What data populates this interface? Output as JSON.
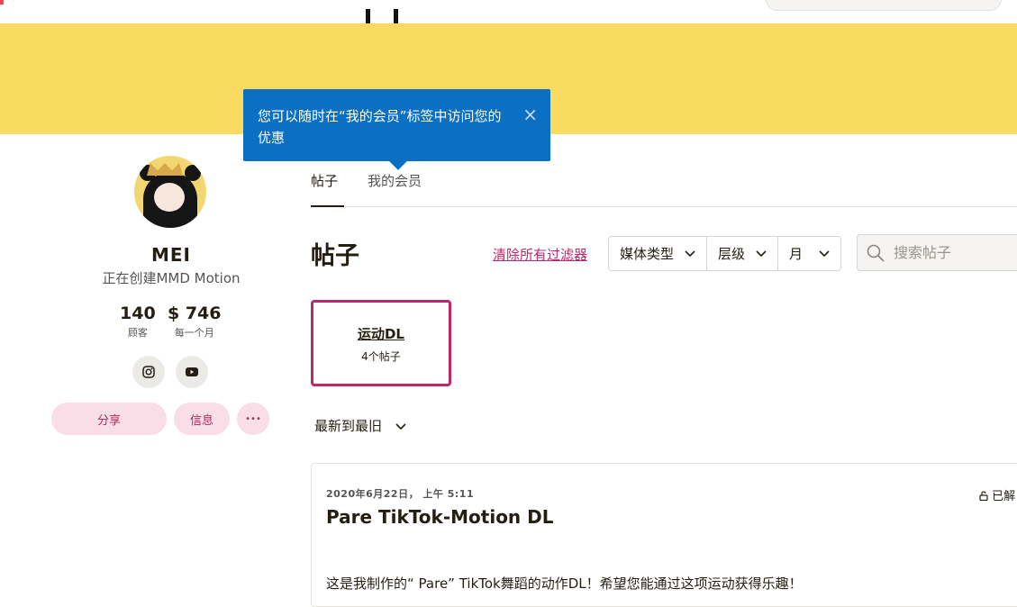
{
  "tooltip": {
    "text": "您可以随时在“我的会员”标签中访问您的优惠",
    "close": "×"
  },
  "profile": {
    "name": "MEI",
    "tagline": "正在创建MMD Motion",
    "stats": [
      {
        "value": "140",
        "label": "顾客"
      },
      {
        "value": "$ 746",
        "label": "每一个月"
      }
    ],
    "social": [
      {
        "icon": "instagram-icon"
      },
      {
        "icon": "youtube-icon"
      }
    ],
    "buttons": {
      "share": "分享",
      "message": "信息",
      "more": "•••"
    }
  },
  "tabs": [
    {
      "label": "帖子",
      "active": true
    },
    {
      "label": "我的会员",
      "active": false
    }
  ],
  "posts_section": {
    "title": "帖子",
    "clear_filters": "清除所有过滤器",
    "filters": [
      {
        "label": "媒体类型"
      },
      {
        "label": "层级"
      },
      {
        "label": "月"
      }
    ],
    "search_placeholder": "搜索帖子"
  },
  "collection": {
    "title": "运动DL",
    "count": "4个帖子"
  },
  "sort": {
    "label": "最新到最旧"
  },
  "post": {
    "date": "2020年6月22日， 上午 5:11",
    "lock_label": "已解",
    "title": "Pare TikTok-Motion DL",
    "body": "这是我制作的“ Pare” TikTok舞蹈的动作DL！希望您能通过这项运动获得乐趣！"
  },
  "colors": {
    "banner": "#f9db62",
    "tooltip": "#0b6fc2",
    "accent": "#c0276a",
    "pink_button_bg": "#f9dde7"
  }
}
